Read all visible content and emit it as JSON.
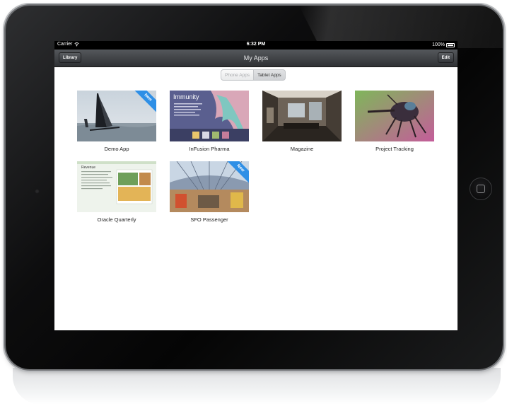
{
  "status_bar": {
    "carrier": "Carrier",
    "time": "6:32 PM",
    "battery_percent": "100%",
    "battery_level": 1.0
  },
  "nav_bar": {
    "left_button": "Library",
    "title": "My Apps",
    "right_button": "Edit"
  },
  "segmented_control": {
    "options": [
      "Phone Apps",
      "Tablet Apps"
    ],
    "selected": "Tablet Apps"
  },
  "apps": [
    {
      "name": "Demo App",
      "badge": "New"
    },
    {
      "name": "InFusion Pharma",
      "badge": "",
      "thumb_text": "Immunity"
    },
    {
      "name": "Magazine",
      "badge": ""
    },
    {
      "name": "Project Tracking",
      "badge": ""
    },
    {
      "name": "Oracle Quarterly",
      "badge": "",
      "thumb_text": "Revenue"
    },
    {
      "name": "SFO Passenger",
      "badge": "New"
    }
  ],
  "colors": {
    "badge": "#2e8fe6",
    "nav_bar": "#3a3c40",
    "bezel": "#0d0d0e"
  }
}
